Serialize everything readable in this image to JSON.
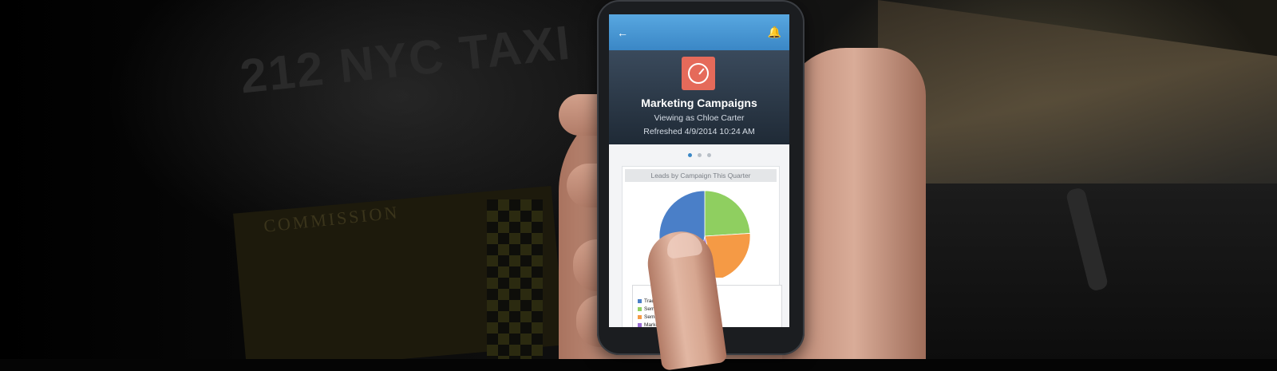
{
  "background": {
    "taxi_text": "212 NYC TAXI",
    "sign_text": "COMMISSION"
  },
  "app": {
    "topbar": {
      "back_icon": "back-arrow-icon",
      "bell_icon": "bell-icon",
      "accent": "#3a87c6"
    },
    "header": {
      "icon": "speedometer-icon",
      "icon_color": "#e56a5a",
      "title": "Marketing Campaigns",
      "subtitle": "Viewing as Chloe Carter",
      "refreshed": "Refreshed 4/9/2014 10:24 AM"
    },
    "pager": {
      "pages": 3,
      "active": 1
    },
    "chart_card": {
      "title": "Leads by Campaign This Quarter"
    },
    "legend": [
      {
        "label": "Tradeshow",
        "suffix": "22",
        "color": "#4a7fc8"
      },
      {
        "label": "Seminar",
        "suffix": "New York",
        "color": "#8fcf60"
      },
      {
        "label": "Seminar",
        "suffix": "",
        "color": "#f59a45"
      },
      {
        "label": "Marketing",
        "suffix": "al",
        "color": "#9b6dd6"
      }
    ]
  },
  "chart_data": {
    "type": "pie",
    "title": "Leads by Campaign This Quarter",
    "slices": [
      {
        "value": 47,
        "color": "#4a7fc8"
      },
      {
        "value": 24,
        "color": "#8fcf60"
      },
      {
        "value": 22,
        "color": "#f59a45"
      },
      {
        "value": 7,
        "color": "#9b6dd6"
      }
    ]
  }
}
